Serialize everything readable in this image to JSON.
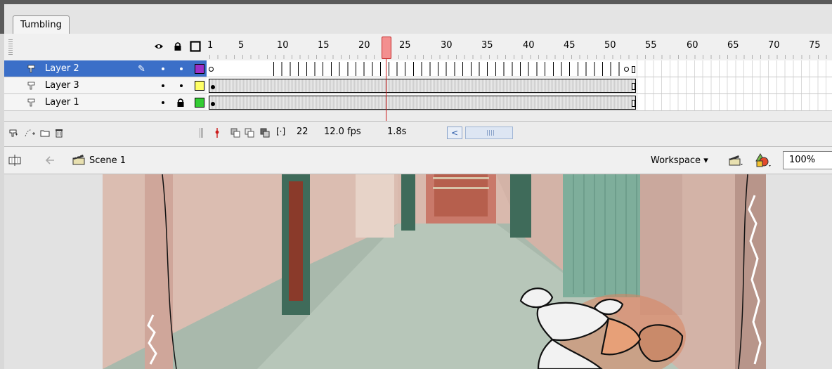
{
  "document_tab": "Tumbling",
  "timeline": {
    "header_icons": [
      "eye-icon",
      "lock-icon",
      "outline-icon"
    ],
    "frame_numbers": [
      "1",
      "5",
      "10",
      "15",
      "20",
      "25",
      "30",
      "35",
      "40",
      "45",
      "50",
      "55",
      "60",
      "65",
      "70",
      "75"
    ],
    "current_frame_marker": 22,
    "layers": [
      {
        "name": "Layer 2",
        "selected": true,
        "visible": true,
        "locked": false,
        "color": "#9b30c8"
      },
      {
        "name": "Layer 3",
        "selected": false,
        "visible": true,
        "locked": false,
        "color": "#ffff66"
      },
      {
        "name": "Layer 1",
        "selected": false,
        "visible": true,
        "locked": true,
        "color": "#33cc33"
      }
    ],
    "footer": {
      "current_frame": "22",
      "frame_rate": "12.0 fps",
      "elapsed_time": "1.8s"
    }
  },
  "editbar": {
    "scene_label": "Scene 1",
    "workspace_label": "Workspace ▾",
    "zoom_value": "100%"
  },
  "colors": {
    "selection": "#3b6fc8",
    "playhead": "#f38f8f",
    "playhead_border": "#c42424"
  }
}
